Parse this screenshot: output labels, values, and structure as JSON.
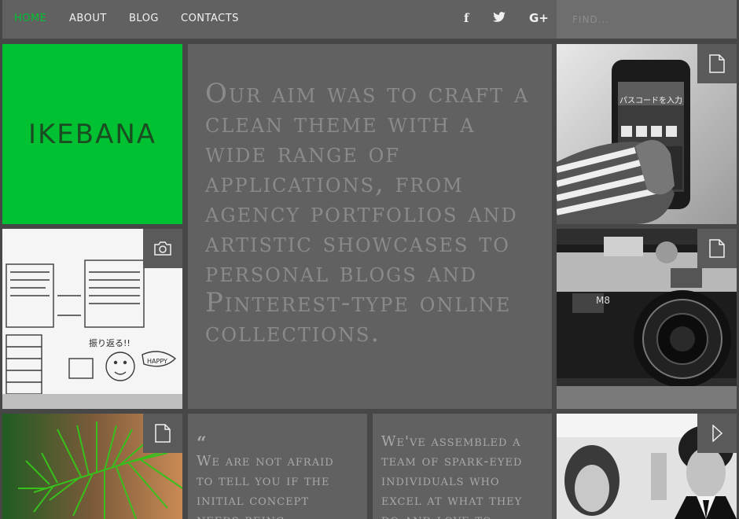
{
  "nav": {
    "items": [
      {
        "label": "HOME",
        "active": true
      },
      {
        "label": "ABOUT",
        "active": false
      },
      {
        "label": "BLOG",
        "active": false
      },
      {
        "label": "CONTACTS",
        "active": false
      }
    ],
    "social": {
      "facebook": "f",
      "twitter": "twitter-icon",
      "googleplus": "G+"
    },
    "search_placeholder": "FIND..."
  },
  "brand": {
    "name": "IKEBANA",
    "color": "#00c132"
  },
  "intro": {
    "text": "Our aim was to craft a clean theme with a wide range of applications, from agency portfolios and artistic showcases to personal blogs and Pinterest-type online collections."
  },
  "tiles": {
    "phone": {
      "icon": "document-icon",
      "screen_text": "パスコードを入力"
    },
    "sketch": {
      "icon": "camera-icon",
      "note_text": "振り返る!!",
      "bubble_text": "HAPPY"
    },
    "camera": {
      "icon": "document-icon"
    },
    "pine": {
      "icon": "document-icon"
    },
    "people": {
      "icon": "play-icon"
    }
  },
  "quotes": [
    {
      "mark": "“",
      "text": "We are not afraid to tell you if the initial concept needs being"
    },
    {
      "text": "We've assembled a team of spark-eyed individuals who excel at what they do and love to"
    }
  ],
  "colors": {
    "accent": "#00c132",
    "tile": "#616161",
    "background": "#474747"
  }
}
